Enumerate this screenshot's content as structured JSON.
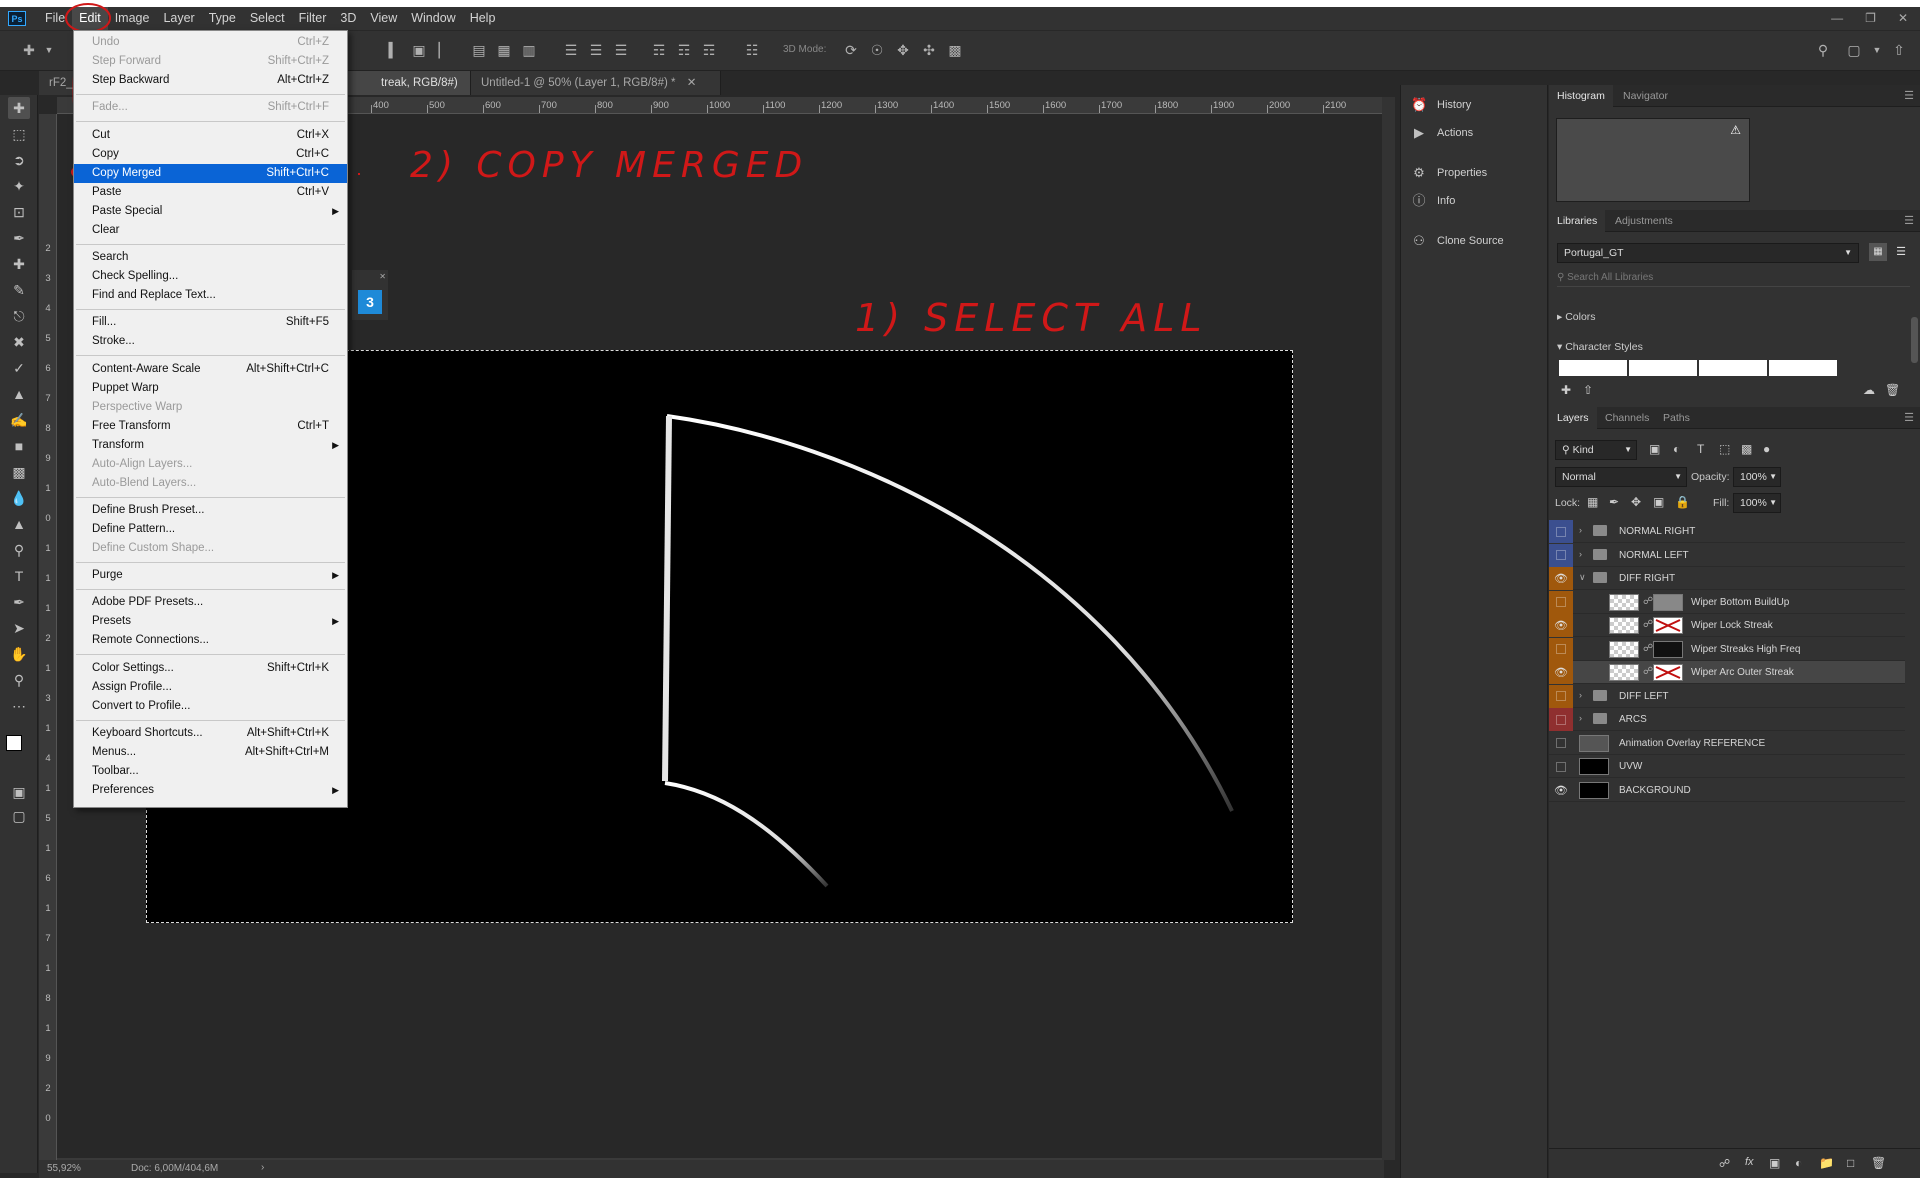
{
  "app": {
    "logo": "Ps"
  },
  "menubar": {
    "items": [
      "File",
      "Edit",
      "Image",
      "Layer",
      "Type",
      "Select",
      "Filter",
      "3D",
      "View",
      "Window",
      "Help"
    ],
    "active": "Edit"
  },
  "optionsbar": {
    "mode_label": "3D Mode:"
  },
  "tabs": [
    {
      "label": "rF2_",
      "active": false
    },
    {
      "label": "treak, RGB/8#) *",
      "active": true
    },
    {
      "label": "Untitled-1 @ 50% (Layer 1, RGB/8#) *",
      "active": false
    }
  ],
  "ruler": {
    "h_labels": [
      "400",
      "500",
      "600",
      "700",
      "800",
      "900",
      "1000",
      "1100",
      "1200",
      "1300",
      "1400",
      "1500",
      "1600",
      "1700",
      "1800",
      "1900",
      "2000",
      "2100"
    ],
    "v_labels": [
      "2",
      "3",
      "4",
      "5",
      "6",
      "7",
      "8",
      "9",
      "1",
      "0",
      "1",
      "1",
      "1",
      "2",
      "1",
      "3",
      "1",
      "4",
      "1",
      "5",
      "1",
      "6",
      "1",
      "7",
      "1",
      "8",
      "1",
      "9",
      "2",
      "0"
    ]
  },
  "status": {
    "zoom": "55,92%",
    "doc": "Doc: 6,00M/404,6M"
  },
  "edit_menu": {
    "items": [
      {
        "label": "Undo",
        "shortcut": "Ctrl+Z",
        "disabled": true
      },
      {
        "label": "Step Forward",
        "shortcut": "Shift+Ctrl+Z",
        "disabled": true
      },
      {
        "label": "Step Backward",
        "shortcut": "Alt+Ctrl+Z"
      },
      {
        "sep": true
      },
      {
        "label": "Fade...",
        "shortcut": "Shift+Ctrl+F",
        "disabled": true
      },
      {
        "sep": true
      },
      {
        "label": "Cut",
        "shortcut": "Ctrl+X"
      },
      {
        "label": "Copy",
        "shortcut": "Ctrl+C"
      },
      {
        "label": "Copy Merged",
        "shortcut": "Shift+Ctrl+C",
        "highlighted": true
      },
      {
        "label": "Paste",
        "shortcut": "Ctrl+V"
      },
      {
        "label": "Paste Special",
        "submenu": true
      },
      {
        "label": "Clear"
      },
      {
        "sep": true
      },
      {
        "label": "Search"
      },
      {
        "label": "Check Spelling..."
      },
      {
        "label": "Find and Replace Text..."
      },
      {
        "sep": true
      },
      {
        "label": "Fill...",
        "shortcut": "Shift+F5"
      },
      {
        "label": "Stroke..."
      },
      {
        "sep": true
      },
      {
        "label": "Content-Aware Scale",
        "shortcut": "Alt+Shift+Ctrl+C"
      },
      {
        "label": "Puppet Warp"
      },
      {
        "label": "Perspective Warp",
        "disabled": true
      },
      {
        "label": "Free Transform",
        "shortcut": "Ctrl+T"
      },
      {
        "label": "Transform",
        "submenu": true
      },
      {
        "label": "Auto-Align Layers...",
        "disabled": true
      },
      {
        "label": "Auto-Blend Layers...",
        "disabled": true
      },
      {
        "sep": true
      },
      {
        "label": "Define Brush Preset..."
      },
      {
        "label": "Define Pattern..."
      },
      {
        "label": "Define Custom Shape...",
        "disabled": true
      },
      {
        "sep": true
      },
      {
        "label": "Purge",
        "submenu": true
      },
      {
        "sep": true
      },
      {
        "label": "Adobe PDF Presets..."
      },
      {
        "label": "Presets",
        "submenu": true
      },
      {
        "label": "Remote Connections..."
      },
      {
        "sep": true
      },
      {
        "label": "Color Settings...",
        "shortcut": "Shift+Ctrl+K"
      },
      {
        "label": "Assign Profile..."
      },
      {
        "label": "Convert to Profile..."
      },
      {
        "sep": true
      },
      {
        "label": "Keyboard Shortcuts...",
        "shortcut": "Alt+Shift+Ctrl+K"
      },
      {
        "label": "Menus...",
        "shortcut": "Alt+Shift+Ctrl+M"
      },
      {
        "label": "Toolbar..."
      },
      {
        "label": "Preferences",
        "submenu": true
      }
    ]
  },
  "annotations": {
    "step1": "1) SELECT ALL",
    "step2": "2) COPY MERGED"
  },
  "collapsed_panels": [
    "History",
    "Actions",
    "Properties",
    "Info",
    "Clone Source"
  ],
  "panels": {
    "top_tabs": [
      "Histogram",
      "Navigator"
    ],
    "lib_tabs": [
      "Libraries",
      "Adjustments"
    ],
    "library_name": "Portugal_GT",
    "library_search_placeholder": "Search All Libraries",
    "colors_label": "Colors",
    "char_styles_label": "Character Styles",
    "layer_tabs": [
      "Layers",
      "Channels",
      "Paths"
    ],
    "filter_kind": "Kind",
    "blend_mode": "Normal",
    "opacity_label": "Opacity:",
    "opacity_value": "100%",
    "lock_label": "Lock:",
    "fill_label": "Fill:",
    "fill_value": "100%"
  },
  "layers": [
    {
      "name": "NORMAL RIGHT",
      "type": "group",
      "color": "#3b4f8f",
      "visible": false,
      "indent": 0,
      "open": false
    },
    {
      "name": "NORMAL LEFT",
      "type": "group",
      "color": "#3b4f8f",
      "visible": false,
      "indent": 0,
      "open": false
    },
    {
      "name": "DIFF RIGHT",
      "type": "group",
      "color": "#a0580c",
      "visible": true,
      "indent": 0,
      "open": true
    },
    {
      "name": "Wiper Bottom BuildUp",
      "type": "layer",
      "color": "#a0580c",
      "visible": false,
      "indent": 1,
      "mask": "noise"
    },
    {
      "name": "Wiper Lock Streak",
      "type": "layer",
      "color": "#a0580c",
      "visible": true,
      "indent": 1,
      "mask": "x"
    },
    {
      "name": "Wiper Streaks High Freq",
      "type": "layer",
      "color": "#a0580c",
      "visible": false,
      "indent": 1,
      "mask": "dark"
    },
    {
      "name": "Wiper Arc Outer Streak",
      "type": "layer",
      "color": "#a0580c",
      "visible": true,
      "indent": 1,
      "mask": "x",
      "selected": true
    },
    {
      "name": "DIFF LEFT",
      "type": "group",
      "color": "#a0580c",
      "visible": false,
      "indent": 0,
      "open": false
    },
    {
      "name": "ARCS",
      "type": "group",
      "color": "#8f2f2f",
      "visible": false,
      "indent": 0,
      "open": false
    },
    {
      "name": "Animation Overlay REFERENCE",
      "type": "layer",
      "color": "",
      "visible": false,
      "indent": 0,
      "thumb": "gray"
    },
    {
      "name": "UVW",
      "type": "layer",
      "color": "",
      "visible": false,
      "indent": 0,
      "thumb": "black"
    },
    {
      "name": "BACKGROUND",
      "type": "layer",
      "color": "",
      "visible": true,
      "indent": 0,
      "thumb": "black"
    }
  ]
}
